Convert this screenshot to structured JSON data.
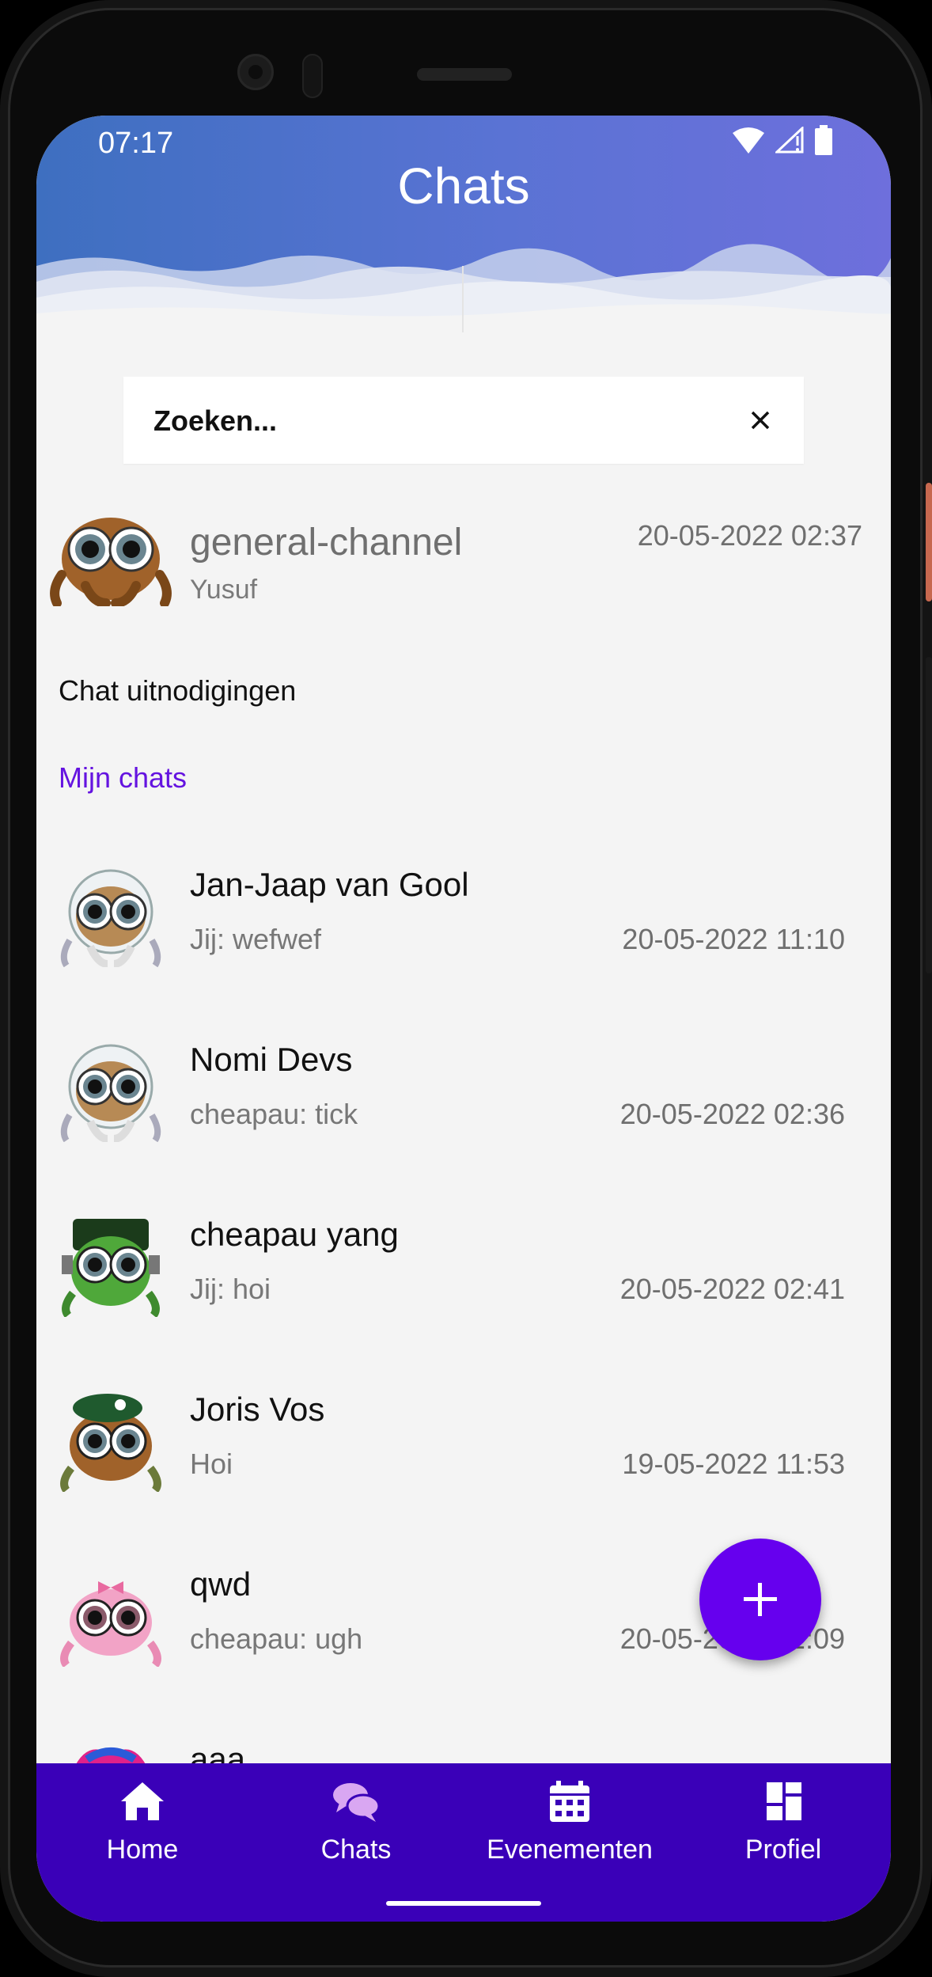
{
  "status": {
    "time": "07:17"
  },
  "header": {
    "title": "Chats"
  },
  "search": {
    "placeholder": "Zoeken..."
  },
  "pinned": {
    "name": "general-channel",
    "subtitle": "Yusuf",
    "time": "20-05-2022 02:37"
  },
  "sections": {
    "invites": "Chat uitnodigingen",
    "mine": "Mijn chats"
  },
  "chats": [
    {
      "name": "Jan-Jaap van Gool",
      "message": "Jij: wefwef",
      "time": "20-05-2022 11:10",
      "avatar": "astronaut-spider"
    },
    {
      "name": "Nomi Devs",
      "message": "cheapau: tick",
      "time": "20-05-2022 02:36",
      "avatar": "astronaut-spider"
    },
    {
      "name": "cheapau yang",
      "message": "Jij: hoi",
      "time": "20-05-2022 02:41",
      "avatar": "frankenstein-spider"
    },
    {
      "name": "Joris Vos",
      "message": "Hoi",
      "time": "19-05-2022 11:53",
      "avatar": "soldier-spider"
    },
    {
      "name": "qwd",
      "message": "cheapau: ugh",
      "time": "20-05-2022 02:09",
      "avatar": "pink-bow-spider"
    },
    {
      "name": "aaa",
      "message": "",
      "time": "",
      "avatar": "jester-spider"
    }
  ],
  "nav": [
    {
      "label": "Home",
      "icon": "home-icon"
    },
    {
      "label": "Chats",
      "icon": "chat-bubbles-icon"
    },
    {
      "label": "Evenementen",
      "icon": "calendar-icon"
    },
    {
      "label": "Profiel",
      "icon": "dashboard-icon"
    }
  ],
  "colors": {
    "accent": "#6600ee",
    "nav_background": "#3a00b8",
    "header_start": "#3e6fc0",
    "header_end": "#6e6fdc",
    "chats_icon_active": "#d9a7f2"
  }
}
